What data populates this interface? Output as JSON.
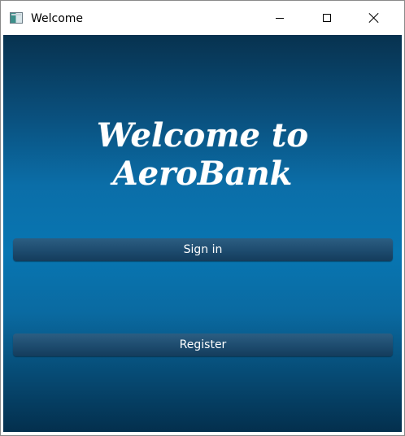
{
  "window": {
    "title": "Welcome"
  },
  "main": {
    "headline": "Welcome to AeroBank",
    "signin_label": "Sign in",
    "register_label": "Register"
  },
  "colors": {
    "background_top": "#07324f",
    "background_mid": "#0876b2",
    "button": "#1d4b6e",
    "text": "#ffffff"
  },
  "icons": [
    "app-icon",
    "minimize-icon",
    "maximize-icon",
    "close-icon"
  ]
}
